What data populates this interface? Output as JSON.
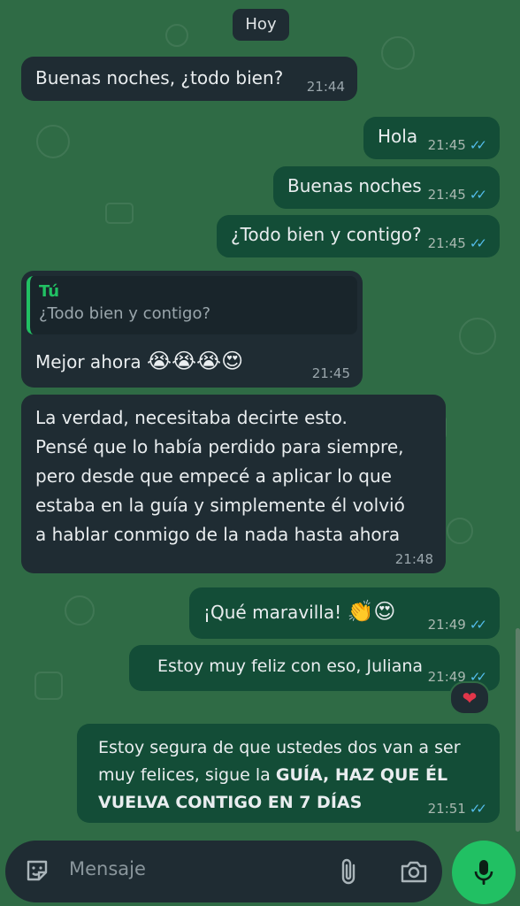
{
  "day_separator": "Hoy",
  "messages": [
    {
      "text": "Buenas noches, ¿todo bien?",
      "time": "21:44"
    },
    {
      "text": "Hola",
      "time": "21:45"
    },
    {
      "text": "Buenas noches",
      "time": "21:45"
    },
    {
      "text": "¿Todo bien y contigo?",
      "time": "21:45"
    },
    {
      "quote_author": "Tú",
      "quote_text": "¿Todo bien y contigo?",
      "text": "Mejor ahora",
      "emojis": "😭😭😭😍",
      "time": "21:45"
    },
    {
      "lines": [
        "La verdad, necesitaba decirte esto.",
        "Pensé que lo había perdido para siempre,",
        "pero desde que empecé a aplicar lo que",
        "estaba en la guía y simplemente él volvió",
        "a hablar conmigo de la nada hasta ahora"
      ],
      "time": "21:48"
    },
    {
      "text": "¡Qué maravilla!",
      "emojis": "👏😍",
      "time": "21:49"
    },
    {
      "text": "Estoy muy feliz con eso, Juliana",
      "time": "21:49",
      "reaction": "❤"
    },
    {
      "line1": "Estoy segura de que ustedes dos van a ser",
      "line2_plain": "muy felices, sigue la ",
      "line2_bold": "GUÍA, HAZ QUE ÉL",
      "line3_bold": "VUELVA CONTIGO EN 7 DÍAS",
      "time": "21:51"
    }
  ],
  "read_ticks": "✓✓",
  "composer": {
    "placeholder": "Mensaje"
  },
  "icons": {
    "sticker": "sticker-icon",
    "attach": "paperclip-icon",
    "camera": "camera-icon",
    "mic": "microphone-icon"
  },
  "colors": {
    "wallpaper": "#2f6b45",
    "incoming": "#1f2c33",
    "outgoing": "#134d37",
    "accent": "#21c063",
    "ticks": "#53bdeb"
  }
}
